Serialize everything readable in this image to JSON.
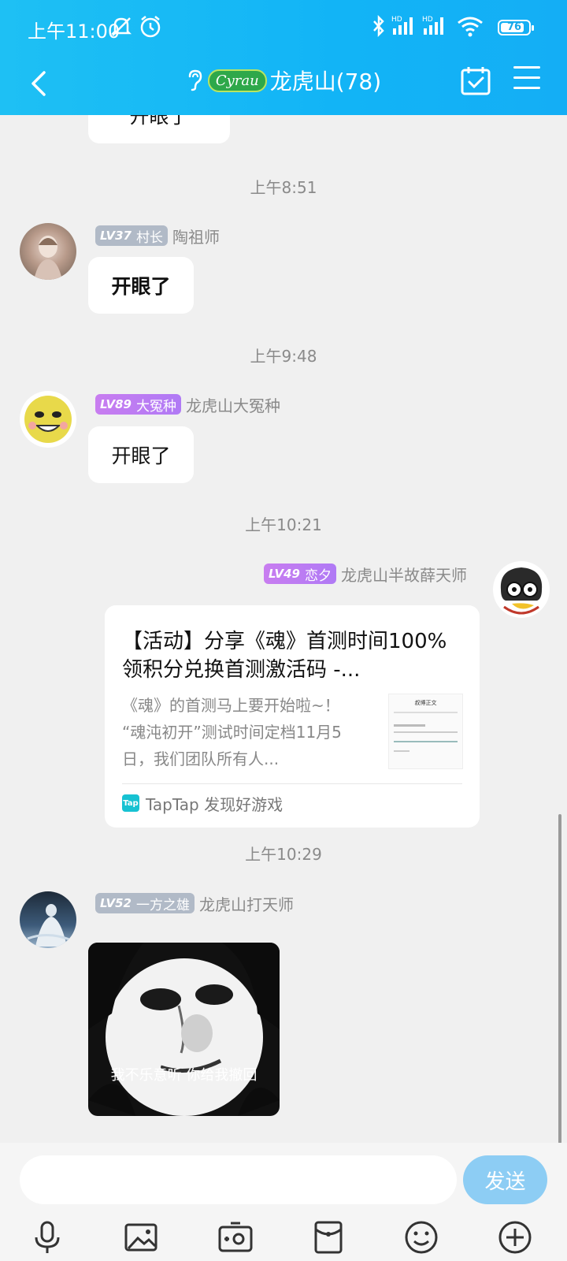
{
  "status": {
    "time": "上午11:00",
    "battery": "76",
    "battery_level": 0.76,
    "hd1": "HD",
    "hd2": "HD"
  },
  "header": {
    "brand_badge": "Cyrau",
    "title": "龙虎山(78)"
  },
  "chat": {
    "partial_bubble": "开眼了",
    "messages": [
      {
        "timestamp": "上午8:51",
        "lv": "LV37",
        "rank": "村长",
        "name": "陶祖师",
        "text": "开眼了"
      },
      {
        "timestamp": "上午9:48",
        "lv": "LV89",
        "rank": "大冤种",
        "name": "龙虎山大冤种",
        "text": "开眼了"
      },
      {
        "timestamp": "上午10:21",
        "lv": "LV49",
        "rank": "恋夕",
        "name": "龙虎山半故薛天师",
        "card": {
          "title": "【活动】分享《魂》首测时间100%领积分兑换首测激活码 -...",
          "desc": "《魂》的首测马上要开始啦~！ “魂沌初开”测试时间定档11月5日，我们团队所有人...",
          "source_logo": "Tap",
          "source": "TapTap 发现好游戏",
          "thumb_title": "叔博正文"
        }
      },
      {
        "timestamp": "上午10:29",
        "lv": "LV52",
        "rank": "一方之雄",
        "name": "龙虎山打天师",
        "sticker_caption": "我不乐意听 你给我撤回"
      }
    ]
  },
  "input": {
    "placeholder": "",
    "send_label": "发送"
  },
  "colors": {
    "header": "#16b6f5",
    "send": "#8dcdf4",
    "lv_gray": "#b1bac7",
    "lv_purple": "#bb7bf3"
  }
}
